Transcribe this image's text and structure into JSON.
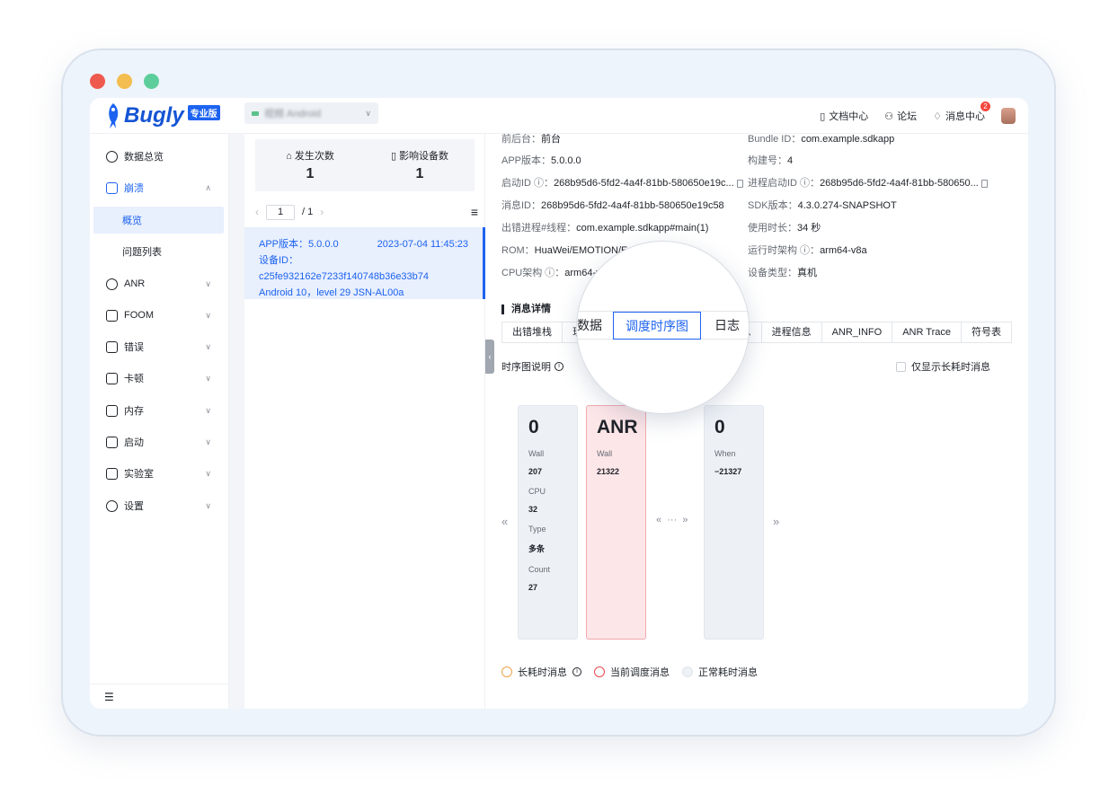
{
  "window": {
    "dot_colors": [
      "#ee5a4e",
      "#f3bd4f",
      "#5dce9b"
    ]
  },
  "header": {
    "logo": "Bugly",
    "logo_badge": "专业版",
    "app_selector": "视频 Android",
    "links": {
      "docs": "文档中心",
      "forum": "论坛",
      "messages": "消息中心",
      "message_count": "2"
    }
  },
  "sidebar": {
    "items": [
      {
        "label": "数据总览",
        "icon": "clock-icon"
      },
      {
        "label": "崩溃",
        "icon": "crash-icon"
      },
      {
        "label": "ANR",
        "icon": "dollar-circle-icon"
      },
      {
        "label": "FOOM",
        "icon": "foom-icon"
      },
      {
        "label": "错误",
        "icon": "error-icon"
      },
      {
        "label": "卡顿",
        "icon": "lag-icon"
      },
      {
        "label": "内存",
        "icon": "memory-icon"
      },
      {
        "label": "启动",
        "icon": "launch-icon"
      },
      {
        "label": "实验室",
        "icon": "lab-icon"
      },
      {
        "label": "设置",
        "icon": "settings-icon"
      }
    ],
    "subitems": {
      "overview": "概览",
      "issues": "问题列表"
    },
    "footer_icon": "collapse-menu-icon"
  },
  "stats": {
    "occurrences_label": "发生次数",
    "occurrences": "1",
    "devices_label": "影响设备数",
    "devices": "1"
  },
  "pager": {
    "current": "1",
    "total": "/ 1"
  },
  "record": {
    "app_version": "APP版本：5.0.0.0",
    "time": "2023-07-04 11:45:23",
    "device": "设备ID：c25fe932162e7233f140748b36e33b74",
    "os": "Android 10，level 29   JSN-AL00a"
  },
  "details": {
    "left": [
      {
        "k": "前后台：",
        "v": "前台"
      },
      {
        "k": "APP版本：",
        "v": "5.0.0.0"
      },
      {
        "k": "启动ID ⓘ：",
        "v": "268b95d6-5fd2-4a4f-81bb-580650e19c..."
      },
      {
        "k": "消息ID：",
        "v": "268b95d6-5fd2-4a4f-81bb-580650e19c58"
      },
      {
        "k": "出错进程#线程：",
        "v": "com.example.sdkapp#main(1)"
      },
      {
        "k": "ROM：",
        "v": "HuaWei/EMOTION/Em..."
      },
      {
        "k": "CPU架构 ⓘ：",
        "v": "arm64-v..."
      }
    ],
    "right": [
      {
        "k": "Bundle ID：",
        "v": "com.example.sdkapp"
      },
      {
        "k": "构建号：",
        "v": "4"
      },
      {
        "k": "进程启动ID ⓘ：",
        "v": "268b95d6-5fd2-4a4f-81bb-580650..."
      },
      {
        "k": "SDK版本：",
        "v": "4.3.0.274-SNAPSHOT"
      },
      {
        "k": "使用时长：",
        "v": "34 秒"
      },
      {
        "k": "运行时架构 ⓘ：",
        "v": "arm64-v8a"
      },
      {
        "k": "设备类型：",
        "v": "真机"
      }
    ]
  },
  "section": {
    "title": "消息详情"
  },
  "tabs": [
    "出错堆栈",
    "现",
    "信息",
    "进程信息",
    "ANR_INFO",
    "ANR Trace",
    "符号表"
  ],
  "magnifier": {
    "left": "数据",
    "active": "调度时序图",
    "right": "日志"
  },
  "seq": {
    "label": "时序图说明",
    "checkbox": "仅显示长耗时消息"
  },
  "cards": [
    {
      "big": "0",
      "fields": [
        {
          "l": "Wall",
          "v": "207"
        },
        {
          "l": "CPU",
          "v": "32"
        },
        {
          "l": "Type",
          "v": "多条"
        },
        {
          "l": "Count",
          "v": "27"
        }
      ]
    },
    {
      "big": "ANR",
      "fields": [
        {
          "l": "Wall",
          "v": "21322"
        }
      ]
    },
    {
      "big": "0",
      "fields": [
        {
          "l": "When",
          "v": "−21327"
        }
      ]
    }
  ],
  "navs": {
    "prev": "«",
    "next": "»",
    "mid_prev": "«",
    "mid_dots": "···",
    "mid_next": "»"
  },
  "legend": [
    {
      "label": "长耗时消息",
      "color": "#f0a14a"
    },
    {
      "label": "当前调度消息",
      "color": "#e5484d"
    },
    {
      "label": "正常耗时消息",
      "color": "#dfe4ea"
    }
  ]
}
